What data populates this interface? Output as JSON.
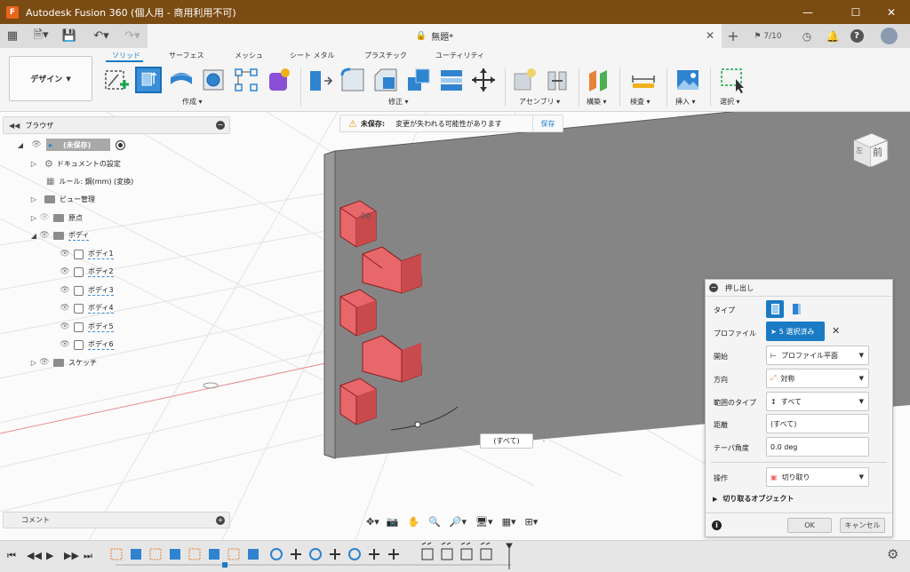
{
  "window": {
    "title": "Autodesk Fusion 360 (個人用 - 商用利用不可)",
    "app_icon": "F",
    "controls": [
      "minimize-icon",
      "maximize-icon",
      "close-icon"
    ]
  },
  "tabbar": {
    "document_title": "無題*",
    "lock_icon": "lock-icon",
    "job_status": "7/10"
  },
  "ribbon": {
    "workspace_label": "デザイン",
    "tabs": [
      {
        "label": "ソリッド",
        "active": true
      },
      {
        "label": "サーフェス",
        "active": false
      },
      {
        "label": "メッシュ",
        "active": false
      },
      {
        "label": "シート メタル",
        "active": false
      },
      {
        "label": "プラスチック",
        "active": false
      },
      {
        "label": "ユーティリティ",
        "active": false
      }
    ],
    "groups": [
      "作成",
      "修正",
      "アセンブリ",
      "構築",
      "検査",
      "挿入",
      "選択"
    ]
  },
  "browser": {
    "title": "ブラウザ",
    "items": [
      {
        "label": "(未保存)"
      },
      {
        "label": "ドキュメントの設定"
      },
      {
        "label": "ルール: 鋼(mm) (変換)"
      },
      {
        "label": "ビュー管理"
      },
      {
        "label": "原点"
      },
      {
        "label": "ボディ"
      },
      {
        "label": "ボディ1"
      },
      {
        "label": "ボディ2"
      },
      {
        "label": "ボディ3"
      },
      {
        "label": "ボディ4"
      },
      {
        "label": "ボディ5"
      },
      {
        "label": "ボディ6"
      },
      {
        "label": "スケッチ"
      }
    ]
  },
  "banner": {
    "title": "未保存:",
    "message": "変更が失われる可能性があります",
    "save_label": "保存"
  },
  "viewcube": {
    "front": "前",
    "left": "左"
  },
  "canvas": {
    "distance_label": "(すべて)",
    "small_label": "00"
  },
  "extrude_dialog": {
    "title": "押し出し",
    "rows": {
      "type_label": "タイプ",
      "profile_label": "プロファイル",
      "profile_value": "5 選択済み",
      "start_label": "開始",
      "start_value": "プロファイル平面",
      "direction_label": "方向",
      "direction_value": "対称",
      "extent_label": "範囲のタイプ",
      "extent_value": "すべて",
      "distance_label": "距離",
      "distance_value": "(すべて)",
      "taper_label": "テーパ角度",
      "taper_value": "0.0 deg",
      "operation_label": "操作",
      "operation_value": "切り取り",
      "objects_label": "切り取るオブジェクト"
    },
    "ok_label": "OK",
    "cancel_label": "キャンセル"
  },
  "comment": {
    "label": "コメント"
  },
  "colors": {
    "titlebar": "#7a4b12",
    "accent": "#1a7bc4",
    "cut_red": "#e8676a",
    "plate": "#858585"
  }
}
